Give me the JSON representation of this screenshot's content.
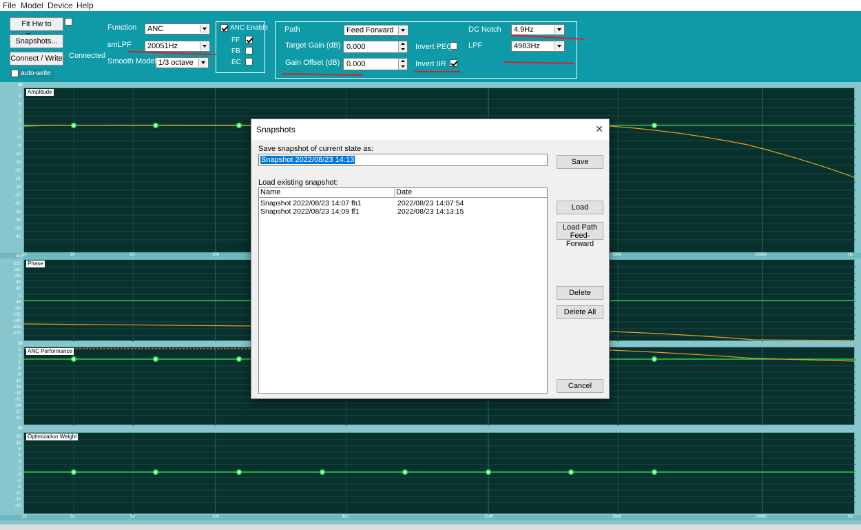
{
  "menu": [
    "File",
    "Model",
    "Device",
    "Help"
  ],
  "toolbar": {
    "fit_label": "Fit Hw to Target",
    "snapshots_label": "Snapshots...",
    "connect_label": "Connect / Write",
    "connected_status": "Connected",
    "autowrite_label": "auto-write",
    "function_label": "Function",
    "function_value": "ANC",
    "smlpf_label": "smLPF",
    "smlpf_value": "20051Hz",
    "smooth_label": "Smooth Model",
    "smooth_value": "1/3 octave",
    "anc_enable_label": "ANC Enable",
    "ff_label": "FF",
    "fb_label": "FB",
    "ec_label": "EC",
    "path_label": "Path",
    "path_value": "Feed Forward",
    "target_gain_label": "Target Gain (dB)",
    "target_gain_value": "0.000",
    "gain_offset_label": "Gain Offset (dB)",
    "gain_offset_value": "0.000",
    "invert_peq_label": "Invert PEQ",
    "invert_iir_label": "Invert IIR",
    "dc_notch_label": "DC Notch",
    "dc_notch_value": "4.9Hz",
    "lpf_label": "LPF",
    "lpf_value": "4983Hz",
    "checked": {
      "anc_enable": true,
      "ff": true,
      "fb": false,
      "ec": false,
      "invert_peq": false,
      "invert_iir": true,
      "autowrite": false,
      "fit": false
    }
  },
  "plots": {
    "amplitude": {
      "title": "Amplitude",
      "unit": "dB",
      "ticks": [
        "9",
        "6",
        "3",
        "0",
        "-3",
        "-6",
        "-9",
        "-12",
        "-15",
        "-18",
        "-21",
        "-24",
        "-27",
        "-30",
        "-33",
        "-36",
        "-39",
        "-42"
      ]
    },
    "phase": {
      "title": "Phase",
      "unit": "deg",
      "ticks": [
        "225",
        "180",
        "135",
        "90",
        "45",
        "0",
        "-45",
        "-90",
        "-135",
        "-180",
        "-225",
        "-270"
      ]
    },
    "anc": {
      "title": "ANC Performance",
      "unit": "dB",
      "ticks": [
        "3",
        "0",
        "-3",
        "-6",
        "-9",
        "-12",
        "-15",
        "-18",
        "-21",
        "-24",
        "-27",
        "-30"
      ]
    },
    "weight": {
      "title": "Optimization Weight",
      "unit": "dB",
      "ticks": [
        "15",
        "12",
        "9",
        "6",
        "3",
        "0",
        "-3",
        "-6",
        "-9",
        "-12",
        "-15",
        "-18"
      ]
    },
    "x_ticks": [
      "20",
      "30",
      "50",
      "100",
      "300",
      "1000",
      "3000",
      "10000",
      "Hz"
    ]
  },
  "dialog": {
    "title": "Snapshots",
    "save_prompt": "Save snapshot of current state as:",
    "save_value": "Snapshot 2022/08/23 14:13",
    "save_button": "Save",
    "load_prompt": "Load existing snapshot:",
    "columns": [
      "Name",
      "Date"
    ],
    "rows": [
      {
        "name": "Snapshot 2022/08/23 14:07 fb1",
        "date": "2022/08/23 14:07:54"
      },
      {
        "name": "Snapshot 2022/08/23 14:09 ff1",
        "date": "2022/08/23 14:13:15"
      }
    ],
    "load_button": "Load",
    "load_path_button_line1": "Load Path",
    "load_path_button_line2": "Feed-Forward",
    "delete_button": "Delete",
    "delete_all_button": "Delete All",
    "cancel_button": "Cancel"
  },
  "colors": {
    "toolbar_bg": "#0f9aa8",
    "plot_bg": "#08302d",
    "trace_green": "#2ee84a",
    "trace_orange": "#e8a020",
    "annotation_red": "#d81f26"
  }
}
